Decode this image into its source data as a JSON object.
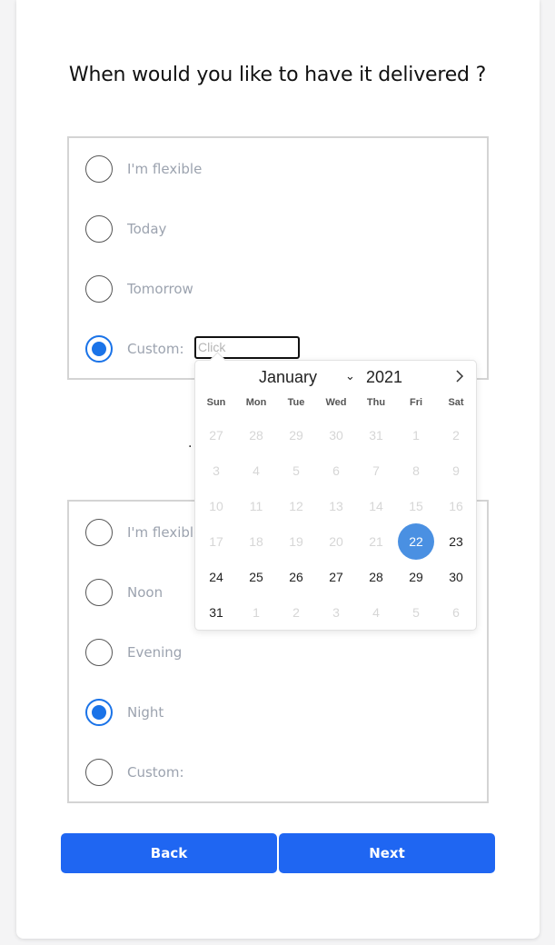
{
  "title": "When would you like to have it delivered ?",
  "date_options": [
    {
      "label": "I'm flexible",
      "selected": false
    },
    {
      "label": "Today",
      "selected": false
    },
    {
      "label": "Tomorrow",
      "selected": false
    },
    {
      "label": "Custom:",
      "selected": true
    }
  ],
  "date_input": {
    "placeholder": "Click"
  },
  "separator": ".",
  "time_options": [
    {
      "label": "I'm flexible",
      "selected": false
    },
    {
      "label": "Noon",
      "selected": false
    },
    {
      "label": "Evening",
      "selected": false
    },
    {
      "label": "Night",
      "selected": true
    },
    {
      "label": "Custom:",
      "selected": false
    }
  ],
  "calendar": {
    "month": "January",
    "year": "2021",
    "weekdays": [
      "Sun",
      "Mon",
      "Tue",
      "Wed",
      "Thu",
      "Fri",
      "Sat"
    ],
    "weeks": [
      [
        {
          "d": "27",
          "m": true
        },
        {
          "d": "28",
          "m": true
        },
        {
          "d": "29",
          "m": true
        },
        {
          "d": "30",
          "m": true
        },
        {
          "d": "31",
          "m": true
        },
        {
          "d": "1",
          "m": true
        },
        {
          "d": "2",
          "m": true
        }
      ],
      [
        {
          "d": "3",
          "m": true
        },
        {
          "d": "4",
          "m": true
        },
        {
          "d": "5",
          "m": true
        },
        {
          "d": "6",
          "m": true
        },
        {
          "d": "7",
          "m": true
        },
        {
          "d": "8",
          "m": true
        },
        {
          "d": "9",
          "m": true
        }
      ],
      [
        {
          "d": "10",
          "m": true
        },
        {
          "d": "11",
          "m": true
        },
        {
          "d": "12",
          "m": true
        },
        {
          "d": "13",
          "m": true
        },
        {
          "d": "14",
          "m": true
        },
        {
          "d": "15",
          "m": true
        },
        {
          "d": "16",
          "m": true
        }
      ],
      [
        {
          "d": "17",
          "m": true
        },
        {
          "d": "18",
          "m": true
        },
        {
          "d": "19",
          "m": true
        },
        {
          "d": "20",
          "m": true
        },
        {
          "d": "21",
          "m": true
        },
        {
          "d": "22",
          "m": false,
          "sel": true
        },
        {
          "d": "23",
          "m": false
        }
      ],
      [
        {
          "d": "24",
          "m": false
        },
        {
          "d": "25",
          "m": false
        },
        {
          "d": "26",
          "m": false
        },
        {
          "d": "27",
          "m": false
        },
        {
          "d": "28",
          "m": false
        },
        {
          "d": "29",
          "m": false
        },
        {
          "d": "30",
          "m": false
        }
      ],
      [
        {
          "d": "31",
          "m": false
        },
        {
          "d": "1",
          "m": true
        },
        {
          "d": "2",
          "m": true
        },
        {
          "d": "3",
          "m": true
        },
        {
          "d": "4",
          "m": true
        },
        {
          "d": "5",
          "m": true
        },
        {
          "d": "6",
          "m": true
        }
      ]
    ]
  },
  "buttons": {
    "back": "Back",
    "next": "Next"
  },
  "colors": {
    "accent": "#1a73e8",
    "button": "#1f66f2",
    "selected_day": "#4a90e2"
  }
}
